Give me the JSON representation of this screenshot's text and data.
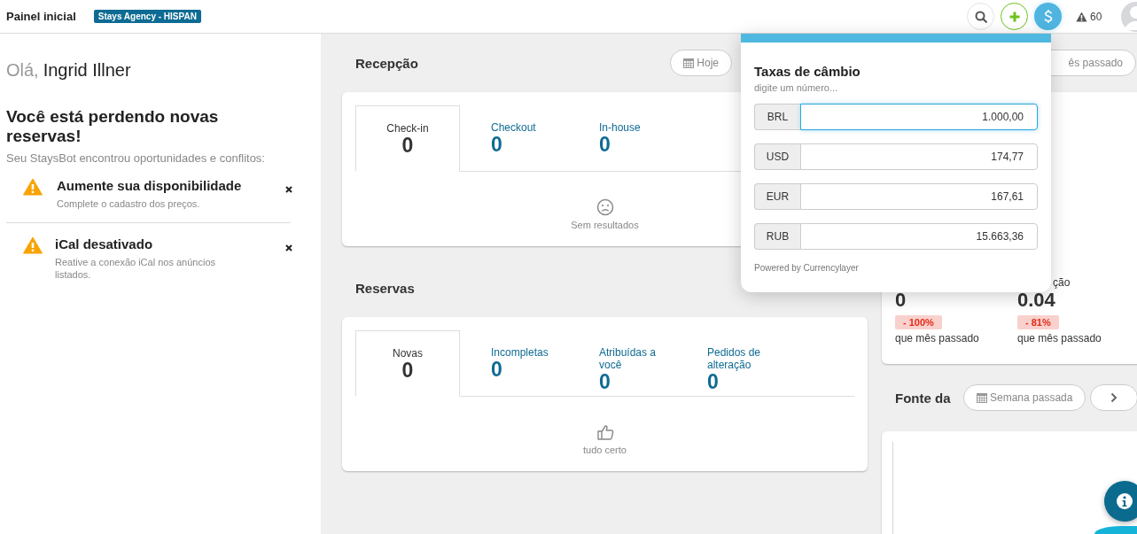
{
  "header": {
    "title": "Painel inicial",
    "agency_badge": "Stays Agency - HISPAN",
    "alerts_count": "60"
  },
  "sidebar": {
    "greeting": "Olá,",
    "user_name": "Ingrid Illner",
    "heading": "Você está perdendo novas reservas!",
    "subheading": "Seu StaysBot encontrou oportunidades e conflitos:",
    "alerts": [
      {
        "title": "Aumente sua disponibilidade",
        "description": "Complete o cadastro dos preços."
      },
      {
        "title": "iCal desativado",
        "description": "Reative a conexão iCal nos anúncios listados."
      }
    ]
  },
  "reception": {
    "title": "Recepção",
    "date_button": "Hoje",
    "tabs": [
      {
        "label": "Check-in",
        "count": "0",
        "selected": true
      },
      {
        "label": "Checkout",
        "count": "0",
        "selected": false
      },
      {
        "label": "In-house",
        "count": "0",
        "selected": false
      }
    ],
    "empty_message": "Sem resultados"
  },
  "reservations": {
    "title": "Reservas",
    "tabs": [
      {
        "label": "Novas",
        "count": "0",
        "selected": true
      },
      {
        "label": "Incompletas",
        "count": "0",
        "selected": false
      },
      {
        "label": "Atribuídas a você",
        "count": "0",
        "selected": false
      },
      {
        "label": "Pedidos de alteração",
        "count": "0",
        "selected": false
      }
    ],
    "empty_message": "tudo certo"
  },
  "stats": {
    "period_button": "ês passado",
    "metrics": [
      {
        "value": "0",
        "change": "- 100%",
        "comparison": "que mês passado"
      },
      {
        "label": "ção",
        "value": "0.04",
        "change": "- 81%",
        "comparison": "que mês passado"
      }
    ]
  },
  "source": {
    "title": "Fonte da",
    "period_button": "Semana passada"
  },
  "exchange_popup": {
    "title": "Taxas de câmbio",
    "hint": "digite um número...",
    "rates": [
      {
        "currency": "BRL",
        "value": "1.000,00",
        "focused": true
      },
      {
        "currency": "USD",
        "value": "174,77",
        "focused": false
      },
      {
        "currency": "EUR",
        "value": "167,61",
        "focused": false
      },
      {
        "currency": "RUB",
        "value": "15.663,36",
        "focused": false
      }
    ],
    "credit": "Powered by Currencylayer"
  }
}
